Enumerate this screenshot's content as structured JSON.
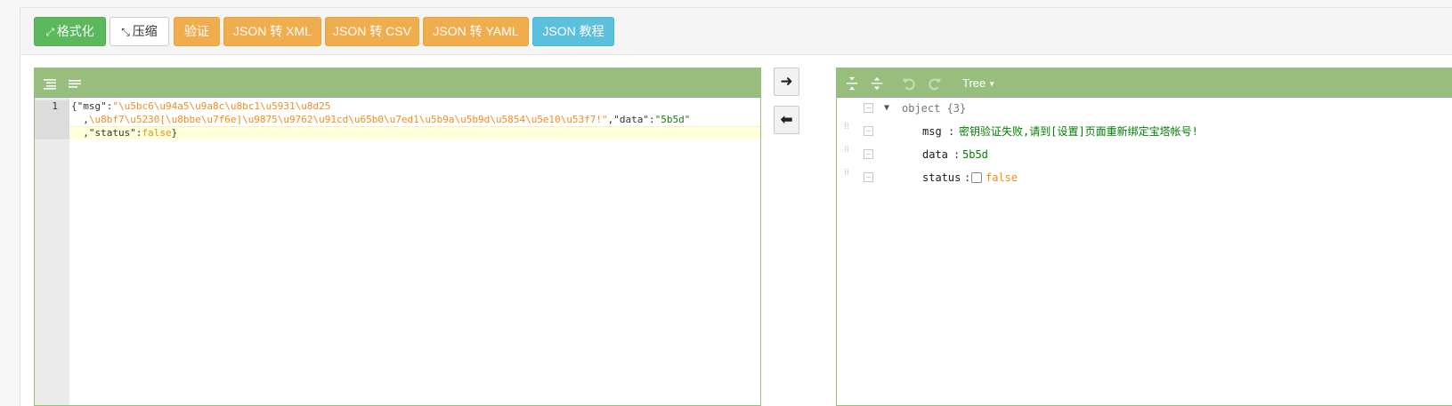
{
  "toolbar": {
    "format_label": "格式化",
    "compress_label": "压缩",
    "validate_label": "验证",
    "to_xml_label": "JSON 转 XML",
    "to_csv_label": "JSON 转 CSV",
    "to_yaml_label": "JSON 转 YAML",
    "tutorial_label": "JSON 教程"
  },
  "code_editor": {
    "line_number": "1",
    "lines": [
      "{\"msg\":\"\\u5bc6\\u94a5\\u9a8c\\u8bc1\\u5931\\u8d25",
      ",\\u8bf7\\u5230[\\u8bbe\\u7f6e]\\u9875\\u9762\\u91cd\\u65b0\\u7ed1\\u5b9a\\u5b9d\\u5854\\u5e10\\u53f7!\",\"data\":\"5b5d\"",
      ",\"status\":false}"
    ],
    "segments": {
      "l1_open": "{",
      "l1_key": "\"msg\"",
      "l1_colon": ":",
      "l1_str": "\"\\u5bc6\\u94a5\\u9a8c\\u8bc1\\u5931\\u8d25",
      "l2_comma": ",",
      "l2_str": "\\u8bf7\\u5230[\\u8bbe\\u7f6e]\\u9875\\u9762\\u91cd\\u65b0\\u7ed1\\u5b9a\\u5b9d\\u5854\\u5e10\\u53f7!\"",
      "l2_comma2": ",",
      "l2_key": "\"data\"",
      "l2_colon": ":",
      "l2_val": "\"5b5d\"",
      "l3_comma": ",",
      "l3_key": "\"status\"",
      "l3_colon": ":",
      "l3_val": "false",
      "l3_close": "}"
    }
  },
  "tree_editor": {
    "mode_label": "Tree",
    "root_label": "object {3}",
    "fields": [
      {
        "key": "msg",
        "value": "密钥验证失败,请到[设置]页面重新绑定宝塔帐号!"
      },
      {
        "key": "data",
        "value": "5b5d"
      },
      {
        "key": "status",
        "value": "false"
      }
    ],
    "separator": ":"
  },
  "icons": {
    "format_icon": "↗",
    "compress_icon": "↙",
    "arrow_right": "➜",
    "arrow_left": "⬅"
  },
  "colors": {
    "panel_header": "#97be7d",
    "success": "#5cb85c",
    "warning": "#f0ad4e",
    "info": "#5bc0de"
  }
}
